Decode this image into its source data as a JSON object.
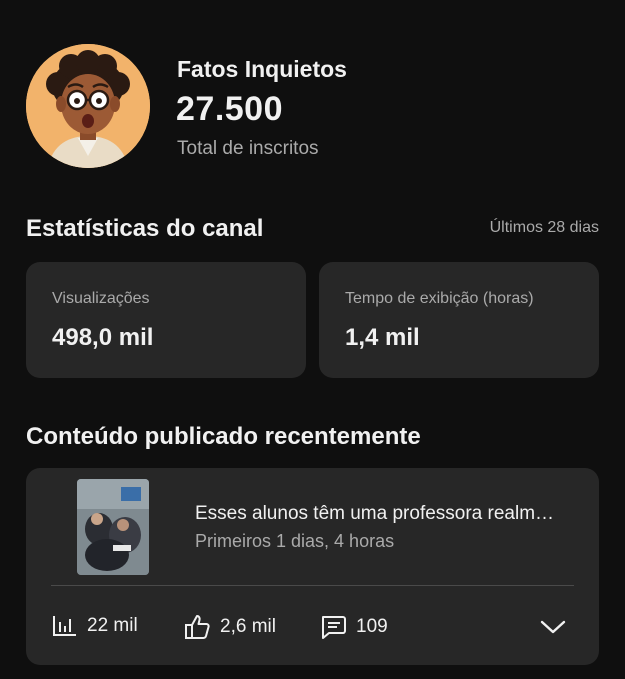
{
  "channel": {
    "name": "Fatos Inquietos",
    "subscriber_count": "27.500",
    "subscriber_label": "Total de inscritos",
    "avatar_icon": "cartoon-avatar"
  },
  "stats": {
    "title": "Estatísticas do canal",
    "period": "Últimos 28 dias",
    "views_label": "Visualizações",
    "views_value": "498,0 mil",
    "watch_label": "Tempo de exibição (horas)",
    "watch_value": "1,4 mil"
  },
  "recent": {
    "title": "Conteúdo publicado recentemente",
    "video": {
      "title": "Esses alunos têm uma professora realm…",
      "subtitle": "Primeiros 1 dias, 4 horas",
      "views": "22 mil",
      "likes": "2,6 mil",
      "comments": "109"
    }
  },
  "colors": {
    "background": "#0f0f0f",
    "card": "#272727",
    "secondary_text": "#aaaaaa"
  }
}
